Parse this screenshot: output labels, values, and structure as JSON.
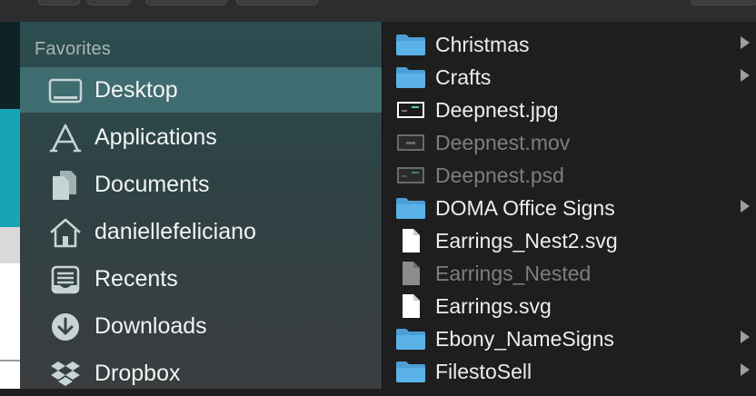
{
  "sidebar": {
    "section_title": "Favorites",
    "items": [
      {
        "label": "Desktop",
        "icon": "desktop-icon",
        "selected": true
      },
      {
        "label": "Applications",
        "icon": "applications-icon"
      },
      {
        "label": "Documents",
        "icon": "documents-icon"
      },
      {
        "label": "daniellefeliciano",
        "icon": "home-icon"
      },
      {
        "label": "Recents",
        "icon": "recents-icon"
      },
      {
        "label": "Downloads",
        "icon": "downloads-icon"
      },
      {
        "label": "Dropbox",
        "icon": "dropbox-icon"
      }
    ]
  },
  "files": [
    {
      "name": "Christmas",
      "kind": "folder",
      "dim": false
    },
    {
      "name": "Crafts",
      "kind": "folder",
      "dim": false
    },
    {
      "name": "Deepnest.jpg",
      "kind": "image",
      "dim": false
    },
    {
      "name": "Deepnest.mov",
      "kind": "video",
      "dim": true
    },
    {
      "name": "Deepnest.psd",
      "kind": "image",
      "dim": true
    },
    {
      "name": "DOMA Office Signs",
      "kind": "folder",
      "dim": false
    },
    {
      "name": "Earrings_Nest2.svg",
      "kind": "document",
      "dim": false
    },
    {
      "name": "Earrings_Nested",
      "kind": "document",
      "dim": true
    },
    {
      "name": "Earrings.svg",
      "kind": "document",
      "dim": false
    },
    {
      "name": "Ebony_NameSigns",
      "kind": "folder",
      "dim": false
    },
    {
      "name": "FilestoSell",
      "kind": "folder",
      "dim": false
    }
  ],
  "colors": {
    "folder": "#5ab2e8",
    "selection": "#3f6c70",
    "list_bg": "#1e1e1e"
  }
}
